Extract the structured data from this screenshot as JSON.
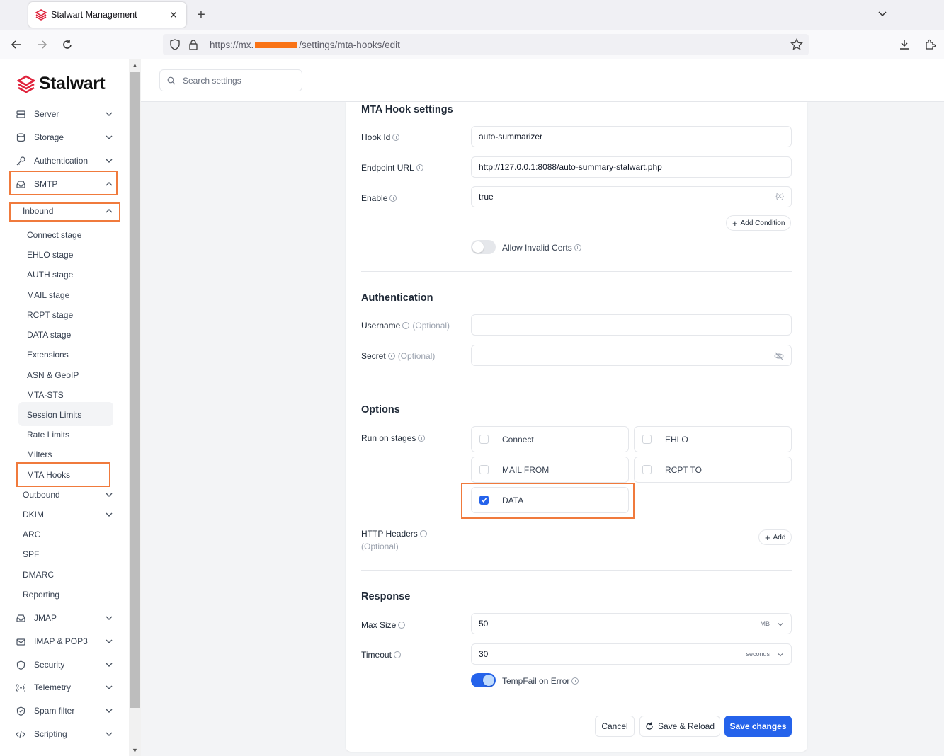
{
  "browser": {
    "tab_title": "Stalwart Management",
    "url_prefix": "https://mx.",
    "url_suffix": "/settings/mta-hooks/edit"
  },
  "brand": {
    "name": "Stalwart",
    "color": "#e0233c"
  },
  "search": {
    "placeholder": "Search settings"
  },
  "sidebar": {
    "top": [
      "Server",
      "Storage",
      "Authentication",
      "SMTP"
    ],
    "smtp_sub": {
      "inbound": "Inbound",
      "inbound_items": [
        "Connect stage",
        "EHLO stage",
        "AUTH stage",
        "MAIL stage",
        "RCPT stage",
        "DATA stage",
        "Extensions",
        "ASN & GeoIP",
        "MTA-STS",
        "Session Limits",
        "Rate Limits",
        "Milters",
        "MTA Hooks"
      ],
      "others": [
        "Outbound",
        "DKIM",
        "ARC",
        "SPF",
        "DMARC",
        "Reporting"
      ]
    },
    "bottom": [
      "JMAP",
      "IMAP & POP3",
      "Security",
      "Telemetry",
      "Spam filter",
      "Scripting"
    ],
    "active_item": "MTA Hooks"
  },
  "form": {
    "hook_settings": {
      "title": "MTA Hook settings",
      "hook_id_label": "Hook Id",
      "hook_id_value": "auto-summarizer",
      "endpoint_label": "Endpoint URL",
      "endpoint_value": "http://127.0.0.1:8088/auto-summary-stalwart.php",
      "enable_label": "Enable",
      "enable_value": "true",
      "enable_trail": "{x}",
      "add_condition": "Add Condition",
      "allow_invalid_certs": "Allow Invalid Certs",
      "allow_invalid_certs_on": false
    },
    "authentication": {
      "title": "Authentication",
      "username_label": "Username",
      "secret_label": "Secret",
      "optional": "(Optional)"
    },
    "options": {
      "title": "Options",
      "stages_label": "Run on stages",
      "stages": [
        {
          "label": "Connect",
          "checked": false
        },
        {
          "label": "EHLO",
          "checked": false
        },
        {
          "label": "MAIL FROM",
          "checked": false
        },
        {
          "label": "RCPT TO",
          "checked": false
        },
        {
          "label": "DATA",
          "checked": true
        }
      ],
      "headers_label": "HTTP Headers",
      "headers_optional": "(Optional)",
      "add": "Add"
    },
    "response": {
      "title": "Response",
      "max_size_label": "Max Size",
      "max_size_value": "50",
      "max_size_unit": "MB",
      "timeout_label": "Timeout",
      "timeout_value": "30",
      "timeout_unit": "seconds",
      "tempfail_label": "TempFail on Error",
      "tempfail_on": true
    },
    "actions": {
      "cancel": "Cancel",
      "save_reload": "Save & Reload",
      "save": "Save changes"
    }
  },
  "colors": {
    "accent": "#2563eb",
    "highlight": "#f07a3c"
  }
}
